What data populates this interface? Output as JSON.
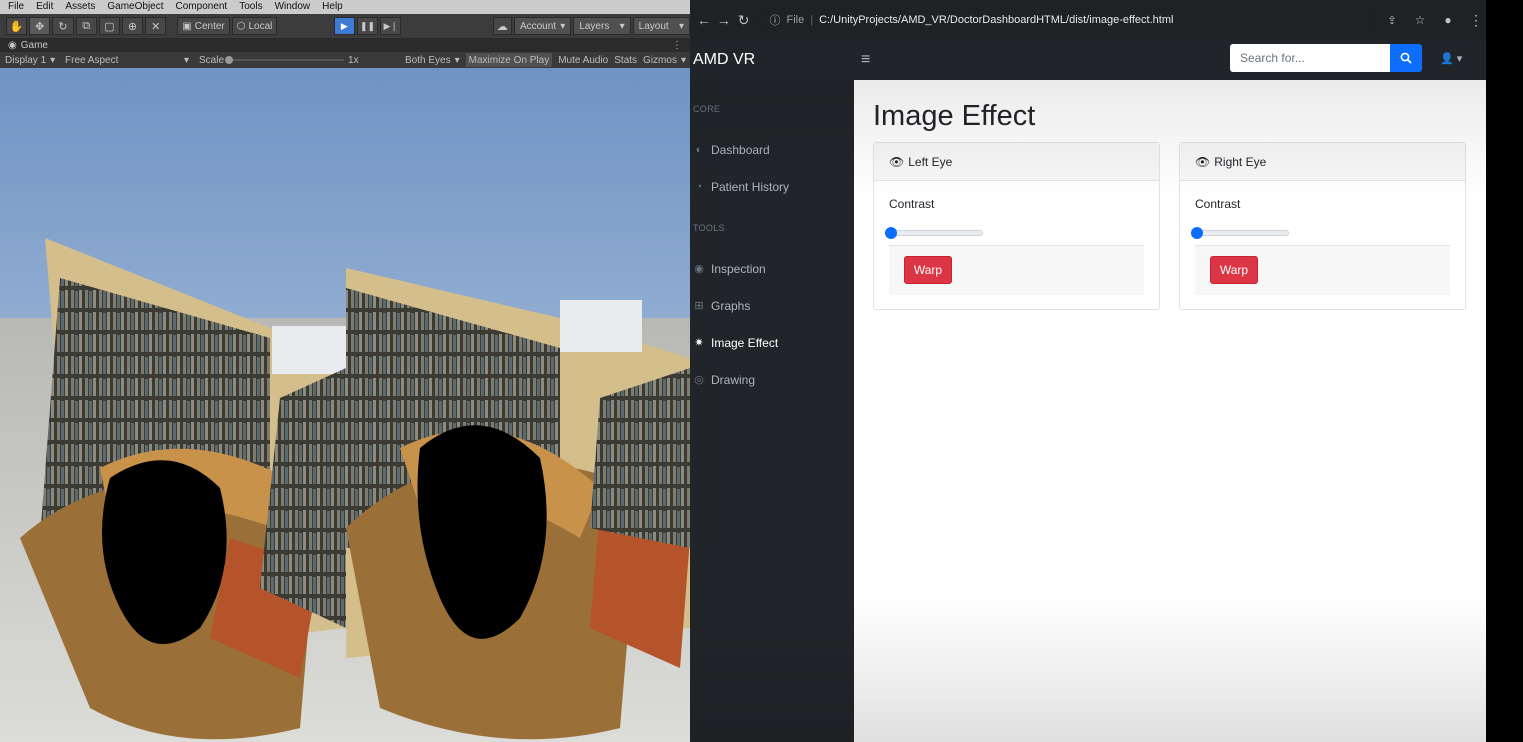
{
  "unity": {
    "menu": [
      "File",
      "Edit",
      "Assets",
      "GameObject",
      "Component",
      "Tools",
      "Window",
      "Help"
    ],
    "toolbar": {
      "pivot_label": "Center",
      "space_label": "Local",
      "account_label": "Account",
      "layers_label": "Layers",
      "layout_label": "Layout"
    },
    "game_tab": {
      "label": "Game"
    },
    "game_bar": {
      "display": "Display 1",
      "aspect": "Free Aspect",
      "scale_label": "Scale",
      "scale_value": "1x",
      "eyes": "Both Eyes",
      "maximize": "Maximize On Play",
      "mute": "Mute Audio",
      "stats": "Stats",
      "gizmos": "Gizmos"
    }
  },
  "browser": {
    "file_label": "File",
    "url": "C:/UnityProjects/AMD_VR/DoctorDashboardHTML/dist/image-effect.html"
  },
  "app": {
    "brand": "AMD VR",
    "search_placeholder": "Search for..."
  },
  "sidebar": {
    "core_heading": "Core",
    "tools_heading": "Tools",
    "core_items": [
      {
        "label": "Dashboard",
        "icon": "gauge-icon"
      },
      {
        "label": "Patient History",
        "icon": "history-icon"
      }
    ],
    "tools_items": [
      {
        "label": "Inspection",
        "icon": "eye-icon"
      },
      {
        "label": "Graphs",
        "icon": "table-icon"
      },
      {
        "label": "Image Effect",
        "icon": "sun-icon"
      },
      {
        "label": "Drawing",
        "icon": "circle-icon"
      }
    ],
    "active": "Image Effect"
  },
  "page": {
    "title": "Image Effect",
    "cards": [
      {
        "header": "Left Eye",
        "contrast_label": "Contrast",
        "contrast_value": 0,
        "button": "Warp"
      },
      {
        "header": "Right Eye",
        "contrast_label": "Contrast",
        "contrast_value": 0,
        "button": "Warp"
      }
    ]
  },
  "colors": {
    "navbar_bg": "#212529",
    "primary": "#0d6efd",
    "danger": "#dc3545"
  }
}
